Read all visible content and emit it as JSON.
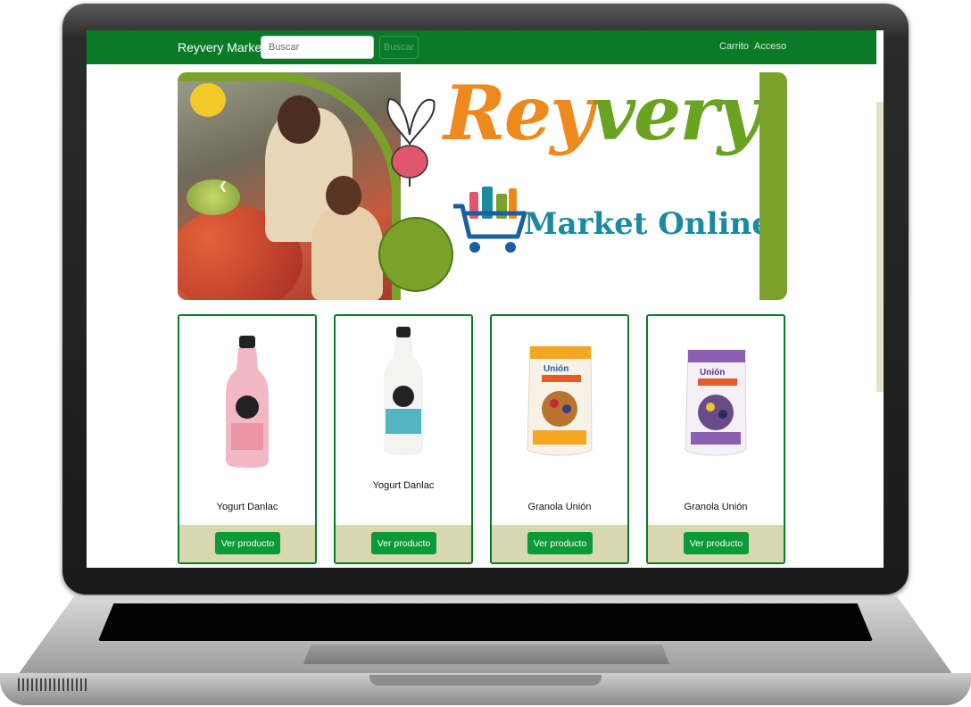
{
  "navbar": {
    "brand": "Reyvery Market",
    "search_placeholder": "Buscar",
    "search_button": "Buscar",
    "links": {
      "cart": "Carrito",
      "login": "Acceso"
    }
  },
  "banner": {
    "logo_word_1": "Rey",
    "logo_word_2": "very",
    "logo_subtitle": "Market Online",
    "carousel_prev_icon": "chevron-left-icon"
  },
  "products": [
    {
      "name": "Yogurt Danlac",
      "button": "Ver producto",
      "image": "yogurt-danlac-pink-bottle"
    },
    {
      "name": "Yogurt Danlac",
      "button": "Ver producto",
      "image": "yogurt-danlac-natural-bottle"
    },
    {
      "name": "Granola Unión",
      "button": "Ver producto",
      "image": "granola-union-orange-bag"
    },
    {
      "name": "Granola Unión",
      "button": "Ver producto",
      "image": "granola-union-purple-bag"
    }
  ],
  "colors": {
    "nav_green": "#0b7a28",
    "button_green": "#0b9a37",
    "card_footer": "#d9d7b0",
    "logo_orange": "#ee8a1d",
    "logo_green": "#6aa31f",
    "logo_blue": "#1b8aa0"
  }
}
